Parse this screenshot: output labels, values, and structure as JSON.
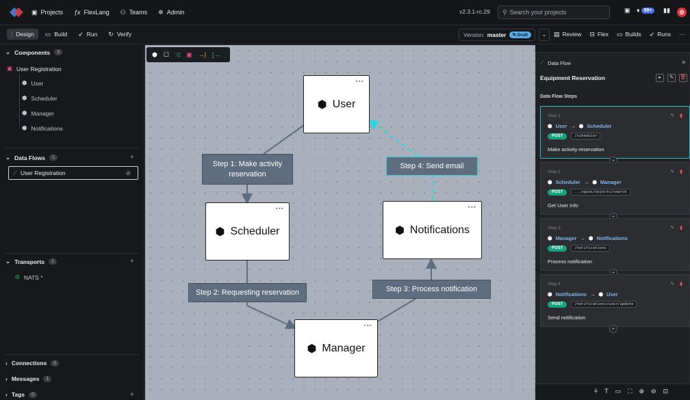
{
  "topbar": {
    "nav": [
      {
        "icon": "briefcase-icon",
        "label": "Projects"
      },
      {
        "icon": "function-icon",
        "label": "FlexLang"
      },
      {
        "icon": "team-icon",
        "label": "Teams"
      },
      {
        "icon": "gear-icon",
        "label": "Admin"
      }
    ],
    "version": "v2.3.1-rc.29",
    "search_placeholder": "Search your projects",
    "notification_count": "99+",
    "avatar_initial": "◎"
  },
  "toolbar": {
    "tabs": [
      "Design",
      "Build",
      "Run",
      "Verify"
    ],
    "version_label": "Version:",
    "version_value": "master",
    "draft_label": "Draft",
    "right_tabs": [
      "Review",
      "Flex",
      "Builds",
      "Runs"
    ]
  },
  "sidebar": {
    "components": {
      "title": "Components",
      "count": "3",
      "root": "User Registration",
      "children": [
        "User",
        "Scheduler",
        "Manager",
        "Notifications"
      ]
    },
    "data_flows": {
      "title": "Data Flows",
      "count": "1",
      "items": [
        "User Registration"
      ]
    },
    "transports": {
      "title": "Transports",
      "count": "1",
      "items": [
        "NATS *"
      ]
    },
    "connections": {
      "title": "Connections",
      "count": "0"
    },
    "messages": {
      "title": "Messages",
      "count": "1"
    },
    "tags": {
      "title": "Tags",
      "count": "0"
    }
  },
  "canvas": {
    "nodes": {
      "user": "User",
      "scheduler": "Scheduler",
      "notifications": "Notifications",
      "manager": "Manager"
    },
    "labels": {
      "step1": "Step 1: Make activity reservation",
      "step2": "Step 2: Requesting reservation",
      "step3": "Step 3: Process notification",
      "step4": "Step 4: Send email"
    },
    "node_menu": "•••"
  },
  "data_flow_panel": {
    "header": "Data Flow",
    "title": "Equipment Reservation",
    "steps_header": "Data Flow Steps",
    "steps": [
      {
        "step": "Step 1",
        "from": "User",
        "to": "Scheduler",
        "method": "POST",
        "path": "/scheduler",
        "desc": "Make activity reservation"
      },
      {
        "step": "Step 2",
        "from": "Scheduler",
        "to": "Manager",
        "method": "POST",
        "path": "...ogies/objects/search",
        "desc": "Get User Info"
      },
      {
        "step": "Step 3",
        "from": "Manager",
        "to": "Notifications",
        "method": "POST",
        "path": "/notifications",
        "desc": "Process notification"
      },
      {
        "step": "Step 4",
        "from": "Notifications",
        "to": "User",
        "method": "POST",
        "path": "/notifications/user/update",
        "desc": "Send notification"
      }
    ]
  },
  "colors": {
    "accent": "#2fc0cc",
    "canvas_bg": "#aab0bb",
    "edge": "#5e6d80",
    "selected_edge": "#34d3e0",
    "post": "#18a37f"
  }
}
